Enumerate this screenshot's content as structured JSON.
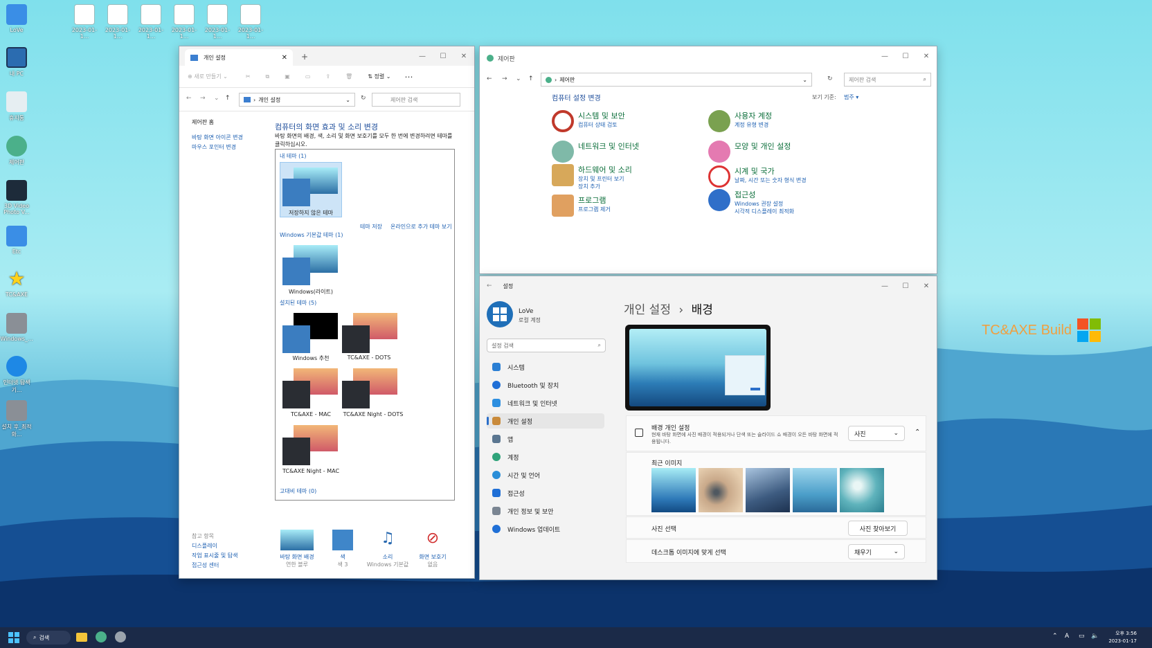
{
  "desktop": {
    "icons": [
      {
        "label": "LoVe"
      },
      {
        "label": "내 PC"
      },
      {
        "label": "휴지통"
      },
      {
        "label": "제어판"
      },
      {
        "label": "3D Video Photo V..."
      },
      {
        "label": "Etc"
      },
      {
        "label": "TC&AXE"
      },
      {
        "label": "Windows_..."
      },
      {
        "label": "인터넷 탐색기..."
      },
      {
        "label": "설치 후_최적화..."
      }
    ],
    "files": [
      "2023-01-1...",
      "2023-01-1...",
      "2023-01-1...",
      "2023-01-1...",
      "2023-01-1...",
      "2023-01-1..."
    ],
    "brand": "TC&AXE Build"
  },
  "personal": {
    "tab": "개인 설정",
    "new": "새로 만들기",
    "sort": "정렬",
    "path": "개인 설정",
    "search": "제어판 검색",
    "home": "제어판 홈",
    "links": [
      "바탕 화면 아이콘 변경",
      "마우스 포인터 변경"
    ],
    "heading": "컴퓨터의 화면 효과 및 소리 변경",
    "desc": "바탕 화면의 배경, 색, 소리 및 화면 보호기를 모두 한 번에 변경하려면 테마를 클릭하십시오.",
    "g1": "내 테마 (1)",
    "unsaved": "저장하지 않은 테마",
    "save": "테마 저장",
    "online": "온라인으로 추가 테마 보기",
    "g2": "Windows 기본값 테마 (1)",
    "light": "Windows(라이트)",
    "g3": "설치된 테마 (5)",
    "themes": [
      "Windows 추천",
      "TC&AXE - DOTS",
      "TC&AXE - MAC",
      "TC&AXE Night - DOTS",
      "TC&AXE Night - MAC"
    ],
    "g4": "고대비 테마 (0)",
    "see": "참고 항목",
    "see_links": [
      "디스플레이",
      "작업 표시줄 및 탐색",
      "접근성 센터"
    ],
    "bottom": [
      {
        "t": "바탕 화면 배경",
        "s": "연한 블루"
      },
      {
        "t": "색",
        "s": "색 3"
      },
      {
        "t": "소리",
        "s": "Windows 기본값"
      },
      {
        "t": "화면 보호기",
        "s": "없음"
      }
    ]
  },
  "control": {
    "title": "제어판",
    "path": "제어판",
    "search": "제어판 검색",
    "heading": "컴퓨터 설정 변경",
    "view_label": "보기 기준:",
    "view_value": "범주",
    "cats": [
      {
        "t": "시스템 및 보안",
        "s": [
          "컴퓨터 상태 검토"
        ]
      },
      {
        "t": "네트워크 및 인터넷",
        "s": []
      },
      {
        "t": "하드웨어 및 소리",
        "s": [
          "장치 및 프린터 보기",
          "장치 추가"
        ]
      },
      {
        "t": "프로그램",
        "s": [
          "프로그램 제거"
        ]
      },
      {
        "t": "사용자 계정",
        "s": [
          "계정 유형 변경"
        ]
      },
      {
        "t": "모양 및 개인 설정",
        "s": []
      },
      {
        "t": "시계 및 국가",
        "s": [
          "날짜, 시간 또는 숫자 형식 변경"
        ]
      },
      {
        "t": "접근성",
        "s": [
          "Windows 권장 설정",
          "시각적 디스플레이 최적화"
        ]
      }
    ]
  },
  "settings": {
    "title": "설정",
    "user": "LoVe",
    "acct": "로컬 계정",
    "search": "설정 검색",
    "nav": [
      "시스템",
      "Bluetooth 및 장치",
      "네트워크 및 인터넷",
      "개인 설정",
      "앱",
      "계정",
      "시간 및 언어",
      "접근성",
      "개인 정보 및 보안",
      "Windows 업데이트"
    ],
    "crumb1": "개인 설정",
    "crumb2": "배경",
    "bg_title": "배경 개인 설정",
    "bg_desc": "현재 바탕 화면에 사진 배경이 적용되거나 단색 또는 슬라이드 쇼 배경이 오든 바탕 화면에 적용됩니다.",
    "bg_value": "사진",
    "recent": "최근 이미지",
    "pick": "사진 선택",
    "browse": "사진 찾아보기",
    "fit": "데스크톱 이미지에 맞게 선택",
    "fit_value": "채우기"
  },
  "taskbar": {
    "search": "검색",
    "time": "오후 3:56",
    "date": "2023-01-17"
  }
}
